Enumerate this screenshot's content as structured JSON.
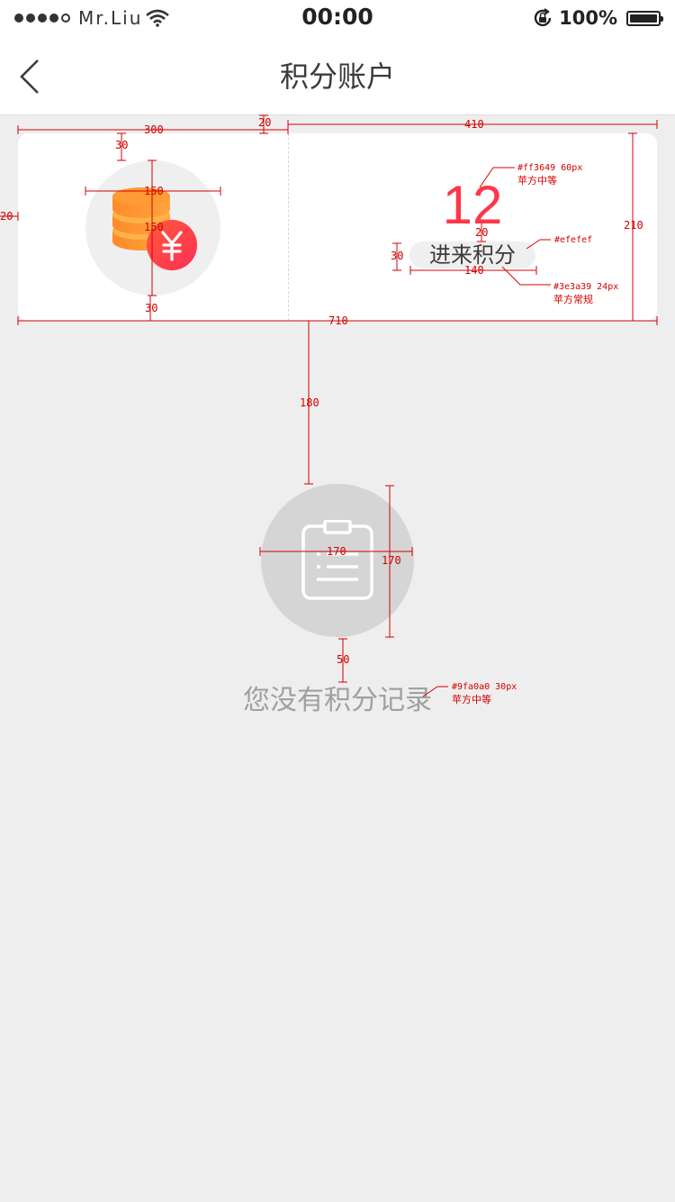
{
  "status_bar": {
    "carrier": "Mr.Liu",
    "time": "00:00",
    "battery": "100%"
  },
  "nav": {
    "title": "积分账户"
  },
  "points_card": {
    "points": "12",
    "earn_button": "进来积分"
  },
  "empty_state": {
    "message": "您没有积分记录"
  },
  "annotations": {
    "dims": {
      "w300": "300",
      "gap20": "20",
      "w410": "410",
      "top30": "30",
      "icon_w150": "150",
      "icon_h150": "150",
      "bottom30": "30",
      "left20": "20",
      "h210": "210",
      "w710": "710",
      "num_gap20": "20",
      "btn_h30": "30",
      "btn_w140": "140",
      "gap180": "180",
      "empty_w170": "170",
      "empty_h170": "170",
      "gap50": "50"
    },
    "notes": {
      "points_color": "#ff3649  60px",
      "points_font": "苹方中等",
      "btn_bg": "#efefef",
      "btn_text": "#3e3a39  24px",
      "btn_font": "苹方常规",
      "empty_color": "#9fa0a0  30px",
      "empty_font": "苹方中等"
    }
  },
  "colors": {
    "accent": "#ff3649",
    "text_dark": "#3e3a39",
    "text_gray": "#9fa0a0",
    "button_bg": "#efefef",
    "page_bg": "#eeeeee",
    "annotation": "#d40000"
  }
}
